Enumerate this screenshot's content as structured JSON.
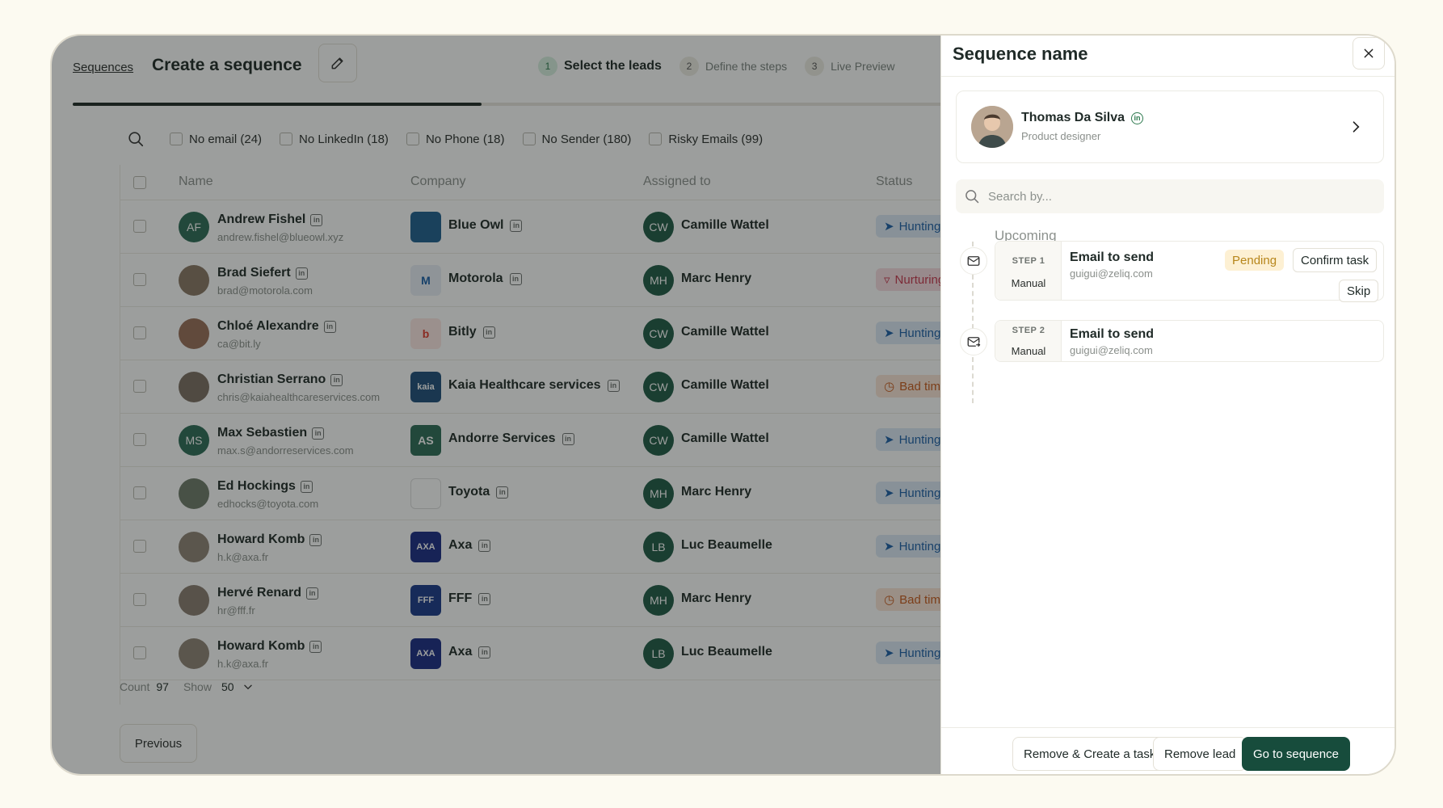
{
  "header": {
    "breadcrumb": "Sequences",
    "title": "Create a sequence",
    "steps": [
      {
        "num": "1",
        "label": "Select the leads"
      },
      {
        "num": "2",
        "label": "Define the steps"
      },
      {
        "num": "3",
        "label": "Live Preview"
      }
    ]
  },
  "filters": [
    "No email (24)",
    "No LinkedIn (18)",
    "No Phone (18)",
    "No Sender (180)",
    "Risky Emails (99)"
  ],
  "table": {
    "columns": [
      "Name",
      "Company",
      "Assigned to",
      "Status"
    ],
    "rows": [
      {
        "initials": "AF",
        "name": "Andrew Fishel",
        "email": "andrew.fishel@blueowl.xyz",
        "company": "Blue Owl",
        "co_initials": "",
        "assignee_initials": "CW",
        "assignee": "Camille Wattel",
        "status": "Hunting"
      },
      {
        "initials": "",
        "name": "Brad Siefert",
        "email": "brad@motorola.com",
        "company": "Motorola",
        "co_initials": "M",
        "assignee_initials": "MH",
        "assignee": "Marc Henry",
        "status": "Nurturing"
      },
      {
        "initials": "",
        "name": "Chloé Alexandre",
        "email": "ca@bit.ly",
        "company": "Bitly",
        "co_initials": "b",
        "assignee_initials": "CW",
        "assignee": "Camille Wattel",
        "status": "Hunting"
      },
      {
        "initials": "",
        "name": "Christian Serrano",
        "email": "chris@kaiahealthcareservices.com",
        "company": "Kaia Healthcare services",
        "co_initials": "kaia",
        "assignee_initials": "CW",
        "assignee": "Camille Wattel",
        "status": "Bad timing"
      },
      {
        "initials": "MS",
        "name": "Max Sebastien",
        "email": "max.s@andorreservices.com",
        "company": "Andorre Services",
        "co_initials": "AS",
        "assignee_initials": "CW",
        "assignee": "Camille Wattel",
        "status": "Hunting"
      },
      {
        "initials": "",
        "name": "Ed Hockings",
        "email": "edhocks@toyota.com",
        "company": "Toyota",
        "co_initials": "",
        "assignee_initials": "MH",
        "assignee": "Marc Henry",
        "status": "Hunting"
      },
      {
        "initials": "",
        "name": "Howard Komb",
        "email": "h.k@axa.fr",
        "company": "Axa",
        "co_initials": "AXA",
        "assignee_initials": "LB",
        "assignee": "Luc Beaumelle",
        "status": "Hunting"
      },
      {
        "initials": "",
        "name": "Hervé Renard",
        "email": "hr@fff.fr",
        "company": "FFF",
        "co_initials": "FFF",
        "assignee_initials": "MH",
        "assignee": "Marc Henry",
        "status": "Bad timing"
      },
      {
        "initials": "",
        "name": "Howard Komb",
        "email": "h.k@axa.fr",
        "company": "Axa",
        "co_initials": "AXA",
        "assignee_initials": "LB",
        "assignee": "Luc Beaumelle",
        "status": "Hunting"
      }
    ]
  },
  "footer": {
    "count_label": "Count",
    "count_value": "97",
    "show_label": "Show",
    "show_value": "50",
    "previous": "Previous"
  },
  "panel": {
    "title": "Sequence name",
    "profile": {
      "name": "Thomas Da Silva",
      "role": "Product designer"
    },
    "search_placeholder": "Search by...",
    "upcoming": "Upcoming",
    "steps": [
      {
        "step": "STEP 1",
        "type": "Manual",
        "title": "Email to send",
        "email": "guigui@zeliq.com",
        "badge": "Pending",
        "confirm": "Confirm task",
        "skip": "Skip"
      },
      {
        "step": "STEP 2",
        "type": "Manual",
        "title": "Email to send",
        "email": "guigui@zeliq.com"
      }
    ],
    "actions": {
      "remove_create": "Remove & Create a task",
      "remove_lead": "Remove lead",
      "go": "Go to sequence"
    }
  },
  "colors": {
    "primary": "#174c3c",
    "hunting": "#1d5fa7",
    "nurturing": "#c8374f",
    "bad_timing": "#c85a1d",
    "pending": "#b7861b"
  }
}
